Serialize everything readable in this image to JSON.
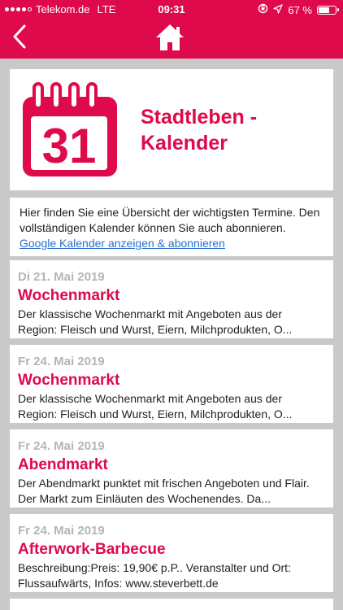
{
  "status_bar": {
    "carrier": "Telekom.de",
    "network": "LTE",
    "time": "09:31",
    "battery": "67 %",
    "battery_level": 0.67
  },
  "nav": {
    "back_icon": "chevron-left-icon",
    "home_icon": "home-icon"
  },
  "header": {
    "calendar_day": "31",
    "title_line1": "Stadtleben -",
    "title_line2": "Kalender"
  },
  "intro": {
    "text": "Hier finden Sie eine Übersicht der wichtigsten Termine. Den vollständigen Kalender können Sie auch abonnieren.",
    "link": "Google Kalender anzeigen & abonnieren"
  },
  "events": [
    {
      "date": "Di 21. Mai 2019",
      "name": "Wochenmarkt",
      "desc_line1": "Der klassische Wochenmarkt mit Angeboten aus der",
      "desc_line2": "Region: Fleisch und Wurst, Eiern, Milchprodukten, O..."
    },
    {
      "date": "Fr 24. Mai 2019",
      "name": "Wochenmarkt",
      "desc_line1": "Der klassische Wochenmarkt mit Angeboten aus der",
      "desc_line2": "Region: Fleisch und Wurst, Eiern, Milchprodukten, O..."
    },
    {
      "date": "Fr 24. Mai 2019",
      "name": "Abendmarkt",
      "desc_line1": "Der Abendmarkt punktet mit frischen Angeboten und Flair.",
      "desc_line2": "Der Markt zum Einläuten des Wochenendes. Da..."
    },
    {
      "date": "Fr 24. Mai 2019",
      "name": "Afterwork-Barbecue",
      "desc_line1": "Beschreibung:Preis: 19,90€ p.P.. Veranstalter und Ort:",
      "desc_line2": "Flussaufwärts, Infos: www.steverbett.de"
    }
  ],
  "colors": {
    "brand": "#de0a4b",
    "background": "#c9c9c9",
    "date_text": "#b5b5b5",
    "link": "#2a6fc9"
  }
}
